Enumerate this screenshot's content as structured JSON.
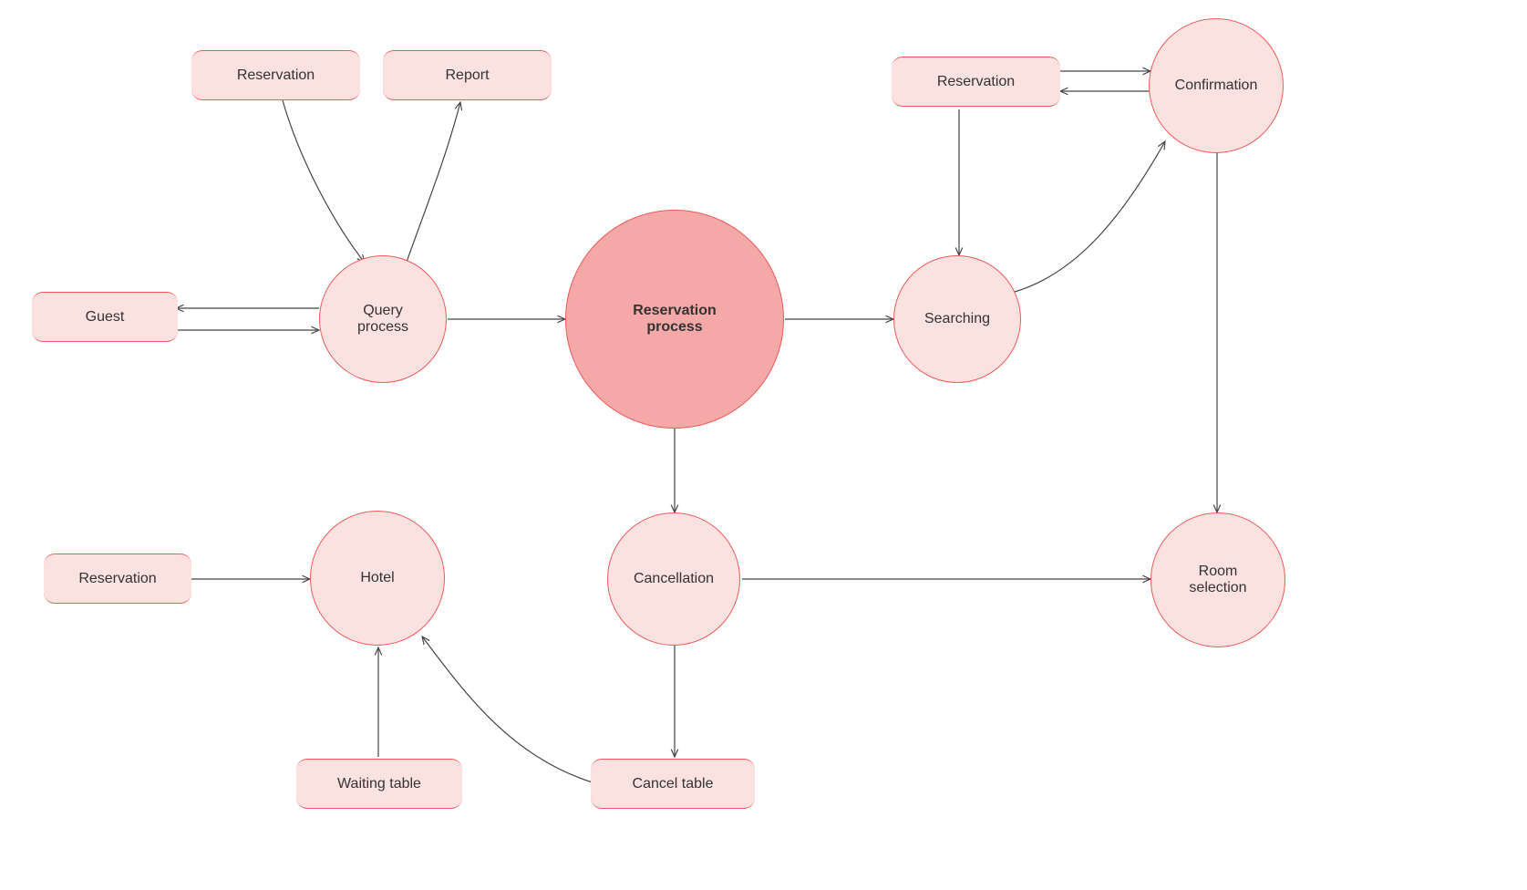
{
  "nodes": {
    "reservation_top_left": "Reservation",
    "report": "Report",
    "guest": "Guest",
    "query_process": "Query\nprocess",
    "reservation_process": "Reservation\nprocess",
    "searching": "Searching",
    "reservation_top_right": "Reservation",
    "confirmation": "Confirmation",
    "reservation_bottom_left": "Reservation",
    "hotel": "Hotel",
    "cancellation": "Cancellation",
    "room_selection": "Room\nselection",
    "waiting_table": "Waiting table",
    "cancel_table": "Cancel table"
  },
  "diagram": {
    "type": "data-flow-diagram",
    "processes": [
      "Query process",
      "Reservation process",
      "Searching",
      "Confirmation",
      "Hotel",
      "Cancellation",
      "Room selection"
    ],
    "datastores": [
      "Reservation",
      "Report",
      "Guest",
      "Waiting table",
      "Cancel table"
    ],
    "edges": [
      {
        "from": "Reservation (top-left)",
        "to": "Query process"
      },
      {
        "from": "Query process",
        "to": "Report"
      },
      {
        "from": "Guest",
        "to": "Query process",
        "bidirectional": true
      },
      {
        "from": "Query process",
        "to": "Reservation process"
      },
      {
        "from": "Reservation process",
        "to": "Searching"
      },
      {
        "from": "Reservation process",
        "to": "Cancellation"
      },
      {
        "from": "Searching",
        "to": "Confirmation"
      },
      {
        "from": "Reservation (top-right)",
        "to": "Confirmation",
        "bidirectional": true
      },
      {
        "from": "Reservation (top-right)",
        "to": "Searching"
      },
      {
        "from": "Confirmation",
        "to": "Room selection"
      },
      {
        "from": "Cancellation",
        "to": "Room selection"
      },
      {
        "from": "Cancellation",
        "to": "Cancel table"
      },
      {
        "from": "Cancel table",
        "to": "Hotel"
      },
      {
        "from": "Waiting table",
        "to": "Hotel"
      },
      {
        "from": "Reservation (bottom-left)",
        "to": "Hotel"
      }
    ]
  }
}
